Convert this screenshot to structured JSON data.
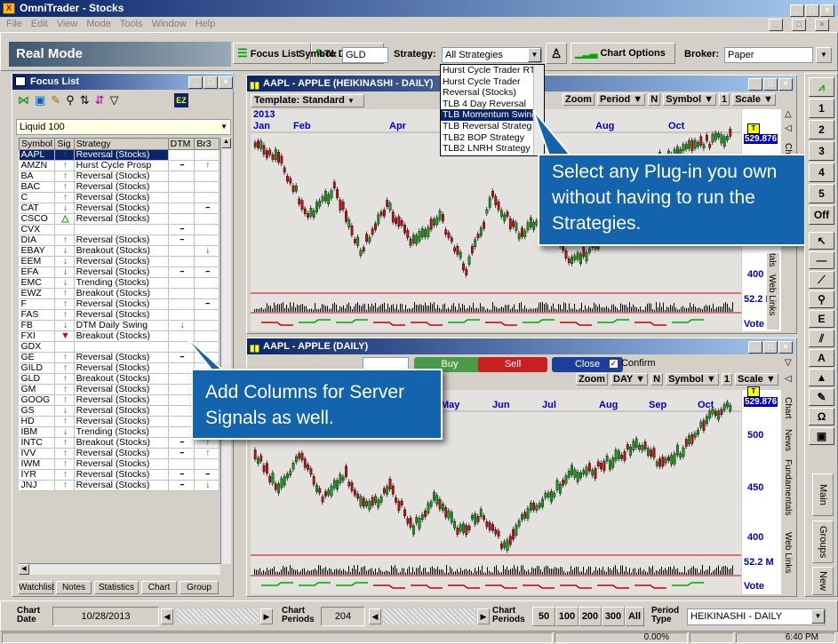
{
  "app": {
    "title": "OmniTrader - Stocks"
  },
  "menu": [
    "File",
    "Edit",
    "View",
    "Mode",
    "Tools",
    "Window",
    "Help"
  ],
  "toolbar": {
    "mode": "Real Mode",
    "focus_list": "Focus List",
    "todo_list": "To Do List",
    "symbol_label": "Symbol:",
    "symbol_value": "GLD",
    "strategy_label": "Strategy:",
    "strategy_value": "All Strategies",
    "chart_options": "Chart Options",
    "broker_label": "Broker:",
    "broker_value": "Paper"
  },
  "strategy_menu": {
    "items": [
      "Hurst Cycle Trader RT",
      "Hurst Cycle Trader",
      "Reversal (Stocks)",
      "TLB 4 Day Reversal",
      "TLB Momentum Swing",
      "TLB Reversal Strateg",
      "TLB2 BOP Strategy",
      "TLB2 LNRH Strategy"
    ],
    "selected": "TLB Momentum Swing"
  },
  "focus": {
    "title": "Focus List",
    "list_name": "Liquid 100",
    "ez": "EZ",
    "columns": [
      "Symbol",
      "Sig",
      "Strategy",
      "DTM",
      "Br3"
    ],
    "rows": [
      [
        "AAPL",
        "up",
        "Reversal (Stocks)",
        "",
        ""
      ],
      [
        "AMZN",
        "up",
        "Hurst Cycle Prosp",
        "-",
        "up"
      ],
      [
        "BA",
        "up",
        "Reversal (Stocks)",
        "",
        ""
      ],
      [
        "BAC",
        "up",
        "Reversal (Stocks)",
        "",
        ""
      ],
      [
        "C",
        "up",
        "Reversal (Stocks)",
        "",
        ""
      ],
      [
        "CAT",
        "dn",
        "Reversal (Stocks)",
        "",
        "-"
      ],
      [
        "CSCO",
        "tri",
        "Reversal (Stocks)",
        "",
        ""
      ],
      [
        "CVX",
        "",
        "",
        "-",
        ""
      ],
      [
        "DIA",
        "up",
        "Reversal (Stocks)",
        "-",
        ""
      ],
      [
        "EBAY",
        "dn",
        "Breakout (Stocks)",
        "",
        "dn"
      ],
      [
        "EEM",
        "dn",
        "Reversal (Stocks)",
        "",
        ""
      ],
      [
        "EFA",
        "dn",
        "Reversal (Stocks)",
        "-",
        "-"
      ],
      [
        "EMC",
        "dn",
        "Trending (Stocks)",
        "",
        ""
      ],
      [
        "EWZ",
        "up",
        "Breakout (Stocks)",
        "",
        ""
      ],
      [
        "F",
        "up",
        "Reversal (Stocks)",
        "",
        "-"
      ],
      [
        "FAS",
        "up",
        "Reversal (Stocks)",
        "",
        ""
      ],
      [
        "FB",
        "dn",
        "DTM Daily Swing",
        "dn",
        ""
      ],
      [
        "FXI",
        "bigdn",
        "Breakout (Stocks)",
        "",
        ""
      ],
      [
        "GDX",
        "",
        "",
        "",
        ""
      ],
      [
        "GE",
        "up",
        "Reversal (Stocks)",
        "-",
        ""
      ],
      [
        "GILD",
        "up",
        "Reversal (Stocks)",
        "",
        ""
      ],
      [
        "GLD",
        "up",
        "Breakout (Stocks)",
        "",
        ""
      ],
      [
        "GM",
        "up",
        "Reversal (Stocks)",
        "",
        ""
      ],
      [
        "GOOG",
        "up",
        "Reversal (Stocks)",
        "",
        "up"
      ],
      [
        "GS",
        "dn",
        "Reversal (Stocks)",
        "",
        "-"
      ],
      [
        "HD",
        "up",
        "Reversal (Stocks)",
        "",
        ""
      ],
      [
        "IBM",
        "dn",
        "Trending (Stocks)",
        "",
        "dn"
      ],
      [
        "INTC",
        "up",
        "Breakout (Stocks)",
        "-",
        "up"
      ],
      [
        "IVV",
        "up",
        "Reversal (Stocks)",
        "-",
        "up"
      ],
      [
        "IWM",
        "up",
        "Reversal (Stocks)",
        "",
        ""
      ],
      [
        "IYR",
        "up",
        "Reversal (Stocks)",
        "-",
        "-"
      ],
      [
        "JNJ",
        "up",
        "Reversal (Stocks)",
        "-",
        "dn"
      ]
    ],
    "tabs": [
      "Watchlist",
      "Notes",
      "Statistics",
      "Chart",
      "Group"
    ]
  },
  "chart1": {
    "title": "AAPL - APPLE (HEIKINASHI - DAILY)",
    "template": "Template: Standard",
    "year": "2013",
    "months": [
      "Jan",
      "Feb",
      "Apr",
      "Aug",
      "Oct"
    ],
    "zoom": "Zoom",
    "period": "Period",
    "n": "N",
    "symbol": "Symbol",
    "one": "1",
    "scale": "Scale",
    "price": "529.876",
    "p400": "400",
    "vol": "52.2 M",
    "vote": "Vote",
    "side_tabs": [
      "Chart",
      "Fundamentals",
      "Web Links"
    ],
    "side_visible": [
      "tals",
      "Web Links"
    ]
  },
  "chart2": {
    "title": "AAPL - APPLE (DAILY)",
    "buy": "Buy",
    "sell": "Sell",
    "close": "Close",
    "confirm": "Confirm",
    "zoom": "Zoom",
    "day": "DAY",
    "n": "N",
    "symbol": "Symbol",
    "one": "1",
    "scale": "Scale",
    "months": [
      "May",
      "Jun",
      "Jul",
      "Aug",
      "Sep",
      "Oct"
    ],
    "price": "529.876",
    "p500": "500",
    "p450": "450",
    "p400": "400",
    "vol": "52.2 M",
    "vote": "Vote",
    "side_tabs": [
      "Chart",
      "News",
      "Fundamentals",
      "Web Links"
    ]
  },
  "callouts": {
    "plugin": "Select any Plug-in you own without having to run the Strategies.",
    "columns": "Add Columns for Server Signals as well."
  },
  "rtool": {
    "buttons": [
      "1",
      "2",
      "3",
      "4",
      "5",
      "Off"
    ],
    "tabs": [
      "Main",
      "Groups",
      "New"
    ]
  },
  "bottom": {
    "chart_date_label": "Chart Date",
    "chart_date": "10/28/2013",
    "periods_label": "Chart Periods",
    "periods": "204",
    "chart_periods_label": "Chart Periods",
    "p50": "50",
    "p100": "100",
    "p200": "200",
    "p300": "300",
    "all": "All",
    "period_type_label": "Period Type",
    "period_type": "HEIKINASHI - DAILY"
  },
  "status": {
    "pct": "0.00%",
    "time": "6:40 PM"
  }
}
